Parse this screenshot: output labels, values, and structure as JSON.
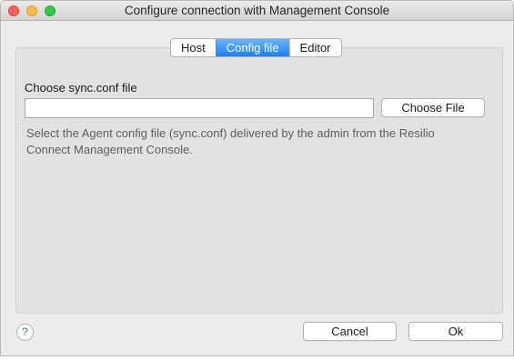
{
  "window": {
    "title": "Configure connection with Management Console"
  },
  "tabs": [
    {
      "label": "Host",
      "active": false
    },
    {
      "label": "Config file",
      "active": true
    },
    {
      "label": "Editor",
      "active": false
    }
  ],
  "config_file": {
    "label": "Choose sync.conf file",
    "input_value": "",
    "choose_button": "Choose File",
    "description": "Select the Agent config file (sync.conf) delivered by the admin from the Resilio Connect Management Console."
  },
  "footer": {
    "help": "?",
    "cancel": "Cancel",
    "ok": "Ok"
  },
  "colors": {
    "accent": "#1a82fb",
    "close": "#fc605c",
    "minimize": "#fdbc40",
    "maximize": "#34c84a"
  }
}
